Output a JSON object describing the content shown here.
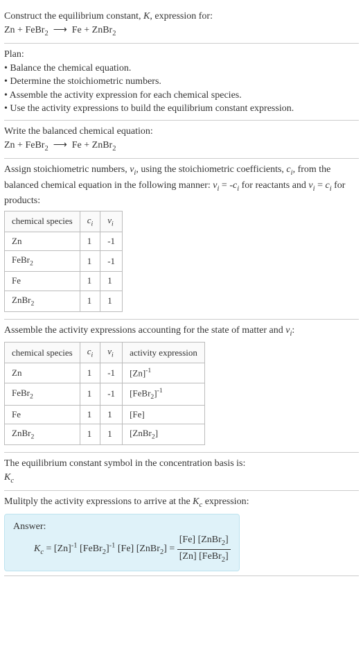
{
  "prompt": {
    "line1": "Construct the equilibrium constant, K, expression for:",
    "reaction": "Zn + FeBr₂ ⟶ Fe + ZnBr₂"
  },
  "plan": {
    "heading": "Plan:",
    "items": [
      "Balance the chemical equation.",
      "Determine the stoichiometric numbers.",
      "Assemble the activity expression for each chemical species.",
      "Use the activity expressions to build the equilibrium constant expression."
    ]
  },
  "balanced": {
    "heading": "Write the balanced chemical equation:",
    "reaction": "Zn + FeBr₂ ⟶ Fe + ZnBr₂"
  },
  "assign": {
    "text1": "Assign stoichiometric numbers, νᵢ, using the stoichiometric coefficients, cᵢ, from the balanced chemical equation in the following manner: νᵢ = -cᵢ for reactants and νᵢ = cᵢ for products:",
    "headers": {
      "species": "chemical species",
      "ci": "cᵢ",
      "vi": "νᵢ"
    },
    "rows": [
      {
        "species": "Zn",
        "ci": "1",
        "vi": "-1"
      },
      {
        "species": "FeBr₂",
        "ci": "1",
        "vi": "-1"
      },
      {
        "species": "Fe",
        "ci": "1",
        "vi": "1"
      },
      {
        "species": "ZnBr₂",
        "ci": "1",
        "vi": "1"
      }
    ]
  },
  "activity": {
    "text": "Assemble the activity expressions accounting for the state of matter and νᵢ:",
    "headers": {
      "species": "chemical species",
      "ci": "cᵢ",
      "vi": "νᵢ",
      "expr": "activity expression"
    },
    "rows": [
      {
        "species": "Zn",
        "ci": "1",
        "vi": "-1",
        "expr": "[Zn]⁻¹"
      },
      {
        "species": "FeBr₂",
        "ci": "1",
        "vi": "-1",
        "expr": "[FeBr₂]⁻¹"
      },
      {
        "species": "Fe",
        "ci": "1",
        "vi": "1",
        "expr": "[Fe]"
      },
      {
        "species": "ZnBr₂",
        "ci": "1",
        "vi": "1",
        "expr": "[ZnBr₂]"
      }
    ]
  },
  "symbol": {
    "text": "The equilibrium constant symbol in the concentration basis is:",
    "value": "K_c"
  },
  "multiply": {
    "text": "Mulitply the activity expressions to arrive at the K_c expression:"
  },
  "answer": {
    "label": "Answer:",
    "lhs": "K_c = [Zn]⁻¹ [FeBr₂]⁻¹ [Fe] [ZnBr₂] = ",
    "frac_num": "[Fe] [ZnBr₂]",
    "frac_den": "[Zn] [FeBr₂]"
  },
  "chart_data": {
    "type": "table",
    "tables": [
      {
        "title": "Stoichiometric numbers",
        "columns": [
          "chemical species",
          "c_i",
          "ν_i"
        ],
        "rows": [
          [
            "Zn",
            1,
            -1
          ],
          [
            "FeBr2",
            1,
            -1
          ],
          [
            "Fe",
            1,
            1
          ],
          [
            "ZnBr2",
            1,
            1
          ]
        ]
      },
      {
        "title": "Activity expressions",
        "columns": [
          "chemical species",
          "c_i",
          "ν_i",
          "activity expression"
        ],
        "rows": [
          [
            "Zn",
            1,
            -1,
            "[Zn]^-1"
          ],
          [
            "FeBr2",
            1,
            -1,
            "[FeBr2]^-1"
          ],
          [
            "Fe",
            1,
            1,
            "[Fe]"
          ],
          [
            "ZnBr2",
            1,
            1,
            "[ZnBr2]"
          ]
        ]
      }
    ],
    "reaction": "Zn + FeBr2 -> Fe + ZnBr2",
    "equilibrium_constant": "K_c = ([Fe][ZnBr2]) / ([Zn][FeBr2])"
  }
}
